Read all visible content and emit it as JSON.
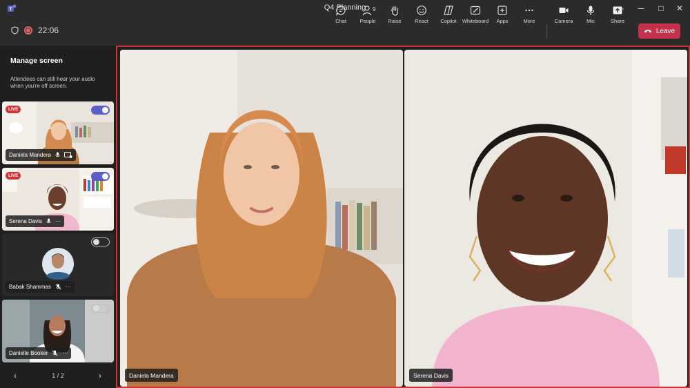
{
  "window": {
    "title": "Q4 Planning",
    "more_label": "···",
    "minimize_label": "─",
    "maximize_label": "□",
    "close_label": "✕"
  },
  "meeting": {
    "timer": "22:06"
  },
  "toolbar": {
    "chat": "Chat",
    "people": "People",
    "people_count": "9",
    "raise": "Raise",
    "react": "React",
    "copilot": "Copilot",
    "whiteboard": "Whiteboard",
    "apps": "Apps",
    "more": "More",
    "camera": "Camera",
    "mic": "Mic",
    "share": "Share",
    "leave": "Leave"
  },
  "sidebar": {
    "title": "Manage screen",
    "note": "Attendees can still hear your audio when you're off screen.",
    "tiles": [
      {
        "name": "Daniela Mandera",
        "live": "LIVE",
        "on_screen": true
      },
      {
        "name": "Serena Davis",
        "live": "LIVE",
        "on_screen": true
      },
      {
        "name": "Babak Shammas",
        "on_screen": false
      },
      {
        "name": "Danielle Booker",
        "on_screen": false
      }
    ],
    "pager": {
      "label": "1 / 2",
      "prev": "‹",
      "next": "›"
    },
    "more_options": "···"
  },
  "stage": {
    "videos": [
      {
        "name": "Daniela Mandera"
      },
      {
        "name": "Serena Davis"
      }
    ]
  },
  "colors": {
    "leave_red": "#c4314b",
    "accent": "#5b5fc7",
    "live_red": "#d13438",
    "stage_border": "#d13438"
  },
  "icons": {
    "app": "teams-logo-icon",
    "shield": "shield-icon",
    "recording": "recording-icon"
  }
}
